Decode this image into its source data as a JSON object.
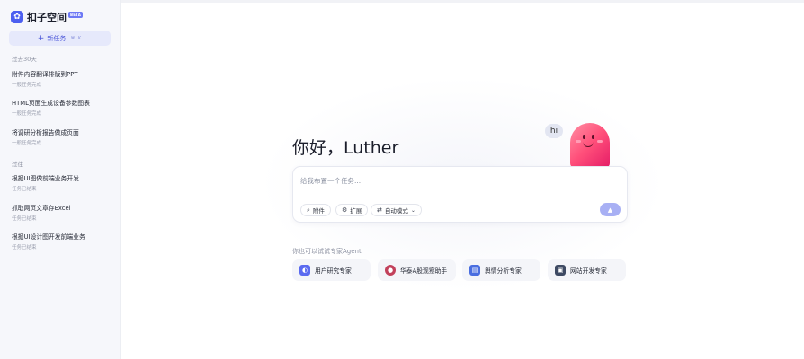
{
  "app": {
    "name": "扣子空间",
    "badge": "BETA",
    "logo_icon": "rabbit-logo-icon"
  },
  "sidebar": {
    "new_task_label": "新任务",
    "new_task_keys": "⌘ K",
    "sections": [
      {
        "label": "过去30天",
        "tasks": [
          {
            "title": "附件内容翻译排版到PPT",
            "status": "一般任务完成"
          },
          {
            "title": "HTML页面生成设备参数图表",
            "status": "一般任务完成"
          },
          {
            "title": "将调研分析报告做成页面",
            "status": "一般任务完成"
          }
        ]
      },
      {
        "label": "过往",
        "tasks": [
          {
            "title": "根据UI图做前端业务开发",
            "status": "任务已结束"
          },
          {
            "title": "抓取网页文章存Excel",
            "status": "任务已结束"
          },
          {
            "title": "根据UI设计图开发前端业务",
            "status": "任务已结束"
          }
        ]
      }
    ]
  },
  "main": {
    "greeting": "你好，Luther",
    "hi_bubble": "hi",
    "input": {
      "placeholder": "给我布置一个任务...",
      "attach_label": "附件",
      "extend_label": "扩展",
      "mode_label": "自动模式"
    },
    "agents_label": "你也可以试试专家Agent",
    "agents": [
      {
        "name": "用户研究专家",
        "icon": "user-research-icon",
        "color": "#5b6bf0"
      },
      {
        "name": "华泰A股观察助手",
        "icon": "stock-avatar-icon",
        "color": "#c2415b"
      },
      {
        "name": "舆情分析专家",
        "icon": "opinion-analysis-icon",
        "color": "#4a6ee0"
      },
      {
        "name": "网站开发专家",
        "icon": "web-dev-icon",
        "color": "#3e4a63"
      }
    ]
  },
  "colors": {
    "accent": "#4c5ff0",
    "mascot": "#ff4f7a",
    "send_button": "#a8b0f4"
  }
}
